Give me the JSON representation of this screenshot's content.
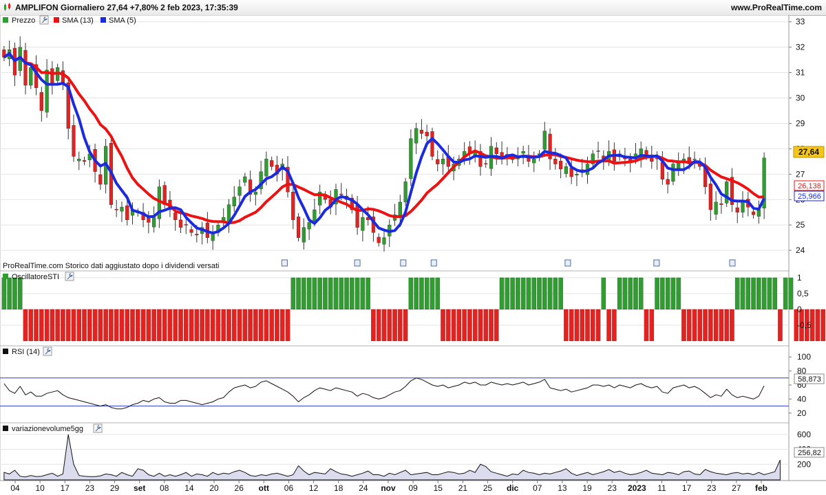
{
  "header": {
    "title": "AMPLIFON Giornaliero 27,64 +7,80% 2 feb 2023, 17:35:39",
    "site": "www.ProRealTime.com"
  },
  "colors": {
    "up": "#2e9e2e",
    "down": "#e8201e",
    "sma13": "#ee1111",
    "sma5": "#1a2ae0",
    "grid": "#e3e3e3",
    "rsi_band": "#2b3acd",
    "last_badge": "#f5c518"
  },
  "price_panel": {
    "legend": [
      {
        "label": "Prezzo",
        "color": "#2e9e2e",
        "has_tool": true
      },
      {
        "label": "SMA (13)",
        "color": "#ee1111",
        "has_tool": false
      },
      {
        "label": "SMA (5)",
        "color": "#1a2ae0",
        "has_tool": false
      }
    ],
    "y_ticks": [
      "33",
      "32",
      "31",
      "30",
      "29",
      "28",
      "27",
      "26",
      "25",
      "24"
    ],
    "last_price": "27,64",
    "sma13_last": "26,138",
    "sma5_last": "25,966",
    "footer_note": "ProRealTime.com  Storico dati aggiustato dopo i dividendi versati"
  },
  "oscillator_panel": {
    "label": "OscillatoreSTI",
    "y_ticks": [
      "1",
      "0,5",
      "0",
      "-0,5"
    ]
  },
  "rsi_panel": {
    "label": "RSI (14)",
    "y_ticks": [
      "100",
      "80",
      "60",
      "40",
      "20"
    ],
    "last_value": "58,873"
  },
  "volume_panel": {
    "label": "variazionevolume5gg",
    "y_ticks": [
      "600",
      "400",
      "200"
    ],
    "last_value": "256,82"
  },
  "x_axis": [
    {
      "label": "04",
      "bold": false
    },
    {
      "label": "10",
      "bold": false
    },
    {
      "label": "17",
      "bold": false
    },
    {
      "label": "23",
      "bold": false
    },
    {
      "label": "29",
      "bold": false
    },
    {
      "label": "set",
      "bold": true
    },
    {
      "label": "08",
      "bold": false
    },
    {
      "label": "14",
      "bold": false
    },
    {
      "label": "20",
      "bold": false
    },
    {
      "label": "26",
      "bold": false
    },
    {
      "label": "ott",
      "bold": true
    },
    {
      "label": "06",
      "bold": false
    },
    {
      "label": "12",
      "bold": false
    },
    {
      "label": "18",
      "bold": false
    },
    {
      "label": "24",
      "bold": false
    },
    {
      "label": "nov",
      "bold": true
    },
    {
      "label": "09",
      "bold": false
    },
    {
      "label": "15",
      "bold": false
    },
    {
      "label": "21",
      "bold": false
    },
    {
      "label": "25",
      "bold": false
    },
    {
      "label": "dic",
      "bold": true
    },
    {
      "label": "07",
      "bold": false
    },
    {
      "label": "13",
      "bold": false
    },
    {
      "label": "19",
      "bold": false
    },
    {
      "label": "23",
      "bold": false
    },
    {
      "label": "2023",
      "bold": true
    },
    {
      "label": "11",
      "bold": false
    },
    {
      "label": "17",
      "bold": false
    },
    {
      "label": "23",
      "bold": false
    },
    {
      "label": "27",
      "bold": false
    },
    {
      "label": "feb",
      "bold": true
    }
  ],
  "chart_data": [
    {
      "type": "candlestick",
      "title": "AMPLIFON Giornaliero",
      "ylim": [
        23.3,
        33.1
      ],
      "note": "approximate daily closes read from chart, 4 Aug 2022 - 2 Feb 2023",
      "close": [
        31.6,
        31.9,
        30.9,
        32.0,
        30.5,
        31.2,
        30.4,
        29.5,
        31.1,
        30.5,
        31.2,
        30.6,
        28.8,
        27.7,
        27.6,
        27.5,
        27.8,
        27.1,
        26.6,
        28.1,
        25.8,
        25.6,
        25.7,
        25.2,
        25.6,
        25.5,
        25.2,
        25.1,
        25.3,
        26.5,
        25.8,
        25.6,
        25.2,
        24.9,
        25.0,
        24.7,
        24.6,
        24.9,
        24.5,
        24.7,
        25.0,
        25.3,
        25.8,
        26.1,
        26.5,
        26.9,
        26.2,
        26.3,
        27.1,
        27.6,
        27.3,
        27.0,
        27.4,
        26.3,
        25.2,
        24.5,
        24.9,
        25.1,
        25.6,
        26.3,
        26.0,
        25.7,
        26.4,
        26.2,
        26.0,
        25.6,
        24.9,
        25.3,
        25.2,
        24.7,
        24.3,
        24.5,
        25.0,
        25.4,
        25.9,
        26.7,
        28.4,
        28.8,
        28.6,
        28.5,
        27.7,
        27.4,
        27.6,
        27.3,
        27.4,
        27.6,
        27.9,
        27.8,
        27.9,
        27.3,
        27.4,
        28.1,
        27.8,
        27.6,
        27.7,
        27.6,
        27.7,
        27.9,
        27.5,
        27.6,
        27.8,
        28.7,
        27.6,
        27.4,
        27.2,
        27.3,
        26.9,
        27.0,
        27.1,
        27.4,
        27.8,
        27.9,
        27.6,
        27.9,
        27.5,
        27.8,
        27.6,
        27.5,
        27.8,
        28.0,
        27.7,
        27.5,
        27.6,
        26.8,
        26.6,
        27.4,
        27.5,
        27.6,
        27.4,
        27.6,
        27.3,
        26.5,
        25.6,
        25.9,
        25.8,
        26.7,
        25.8,
        25.5,
        25.9,
        25.7,
        25.4,
        25.6,
        27.64
      ],
      "series": [
        {
          "name": "SMA (13)",
          "last": 26.138
        },
        {
          "name": "SMA (5)",
          "last": 25.966
        }
      ]
    },
    {
      "type": "bar",
      "title": "OscillatoreSTI",
      "ylim": [
        -1,
        1
      ],
      "values": [
        1,
        1,
        1,
        1,
        -1,
        -1,
        -1,
        -1,
        -1,
        -1,
        -1,
        -1,
        -1,
        -1,
        -1,
        -1,
        -1,
        -1,
        -1,
        -1,
        -1,
        -1,
        -1,
        -1,
        -1,
        -1,
        -1,
        -1,
        -1,
        -1,
        -1,
        -1,
        -1,
        -1,
        -1,
        -1,
        -1,
        -1,
        -1,
        -1,
        -1,
        -1,
        -1,
        -1,
        -1,
        -1,
        -1,
        -1,
        -1,
        -1,
        -1,
        -1,
        -1,
        -1,
        1,
        1,
        1,
        1,
        1,
        1,
        1,
        1,
        1,
        1,
        1,
        1,
        1,
        1,
        1,
        -1,
        -1,
        -1,
        -1,
        -1,
        -1,
        -1,
        1,
        1,
        1,
        1,
        1,
        1,
        -1,
        -1,
        -1,
        -1,
        -1,
        -1,
        -1,
        -1,
        -1,
        -1,
        -1,
        1,
        1,
        1,
        1,
        1,
        1,
        1,
        1,
        1,
        1,
        1,
        1,
        -1,
        -1,
        -1,
        -1,
        -1,
        -1,
        -1,
        1,
        -1,
        -1,
        1,
        1,
        1,
        1,
        1,
        -1,
        -1,
        1,
        1,
        1,
        1,
        1,
        -1,
        -1,
        -1,
        -1,
        -1,
        -1,
        -1,
        -1,
        -1,
        -1,
        1,
        1,
        1,
        1,
        1,
        1,
        1,
        1,
        -1,
        1,
        1,
        -1,
        -1,
        -1,
        -1,
        -1,
        -1,
        -1,
        -1,
        -1,
        -1,
        -1,
        -1,
        -1,
        -1,
        -1,
        -1,
        -1,
        -1,
        1
      ]
    },
    {
      "type": "line",
      "title": "RSI (14)",
      "ylim": [
        10,
        110
      ],
      "bands": [
        30,
        70
      ],
      "values": [
        62,
        52,
        48,
        58,
        46,
        50,
        44,
        44,
        48,
        50,
        52,
        46,
        42,
        40,
        38,
        36,
        34,
        32,
        30,
        32,
        28,
        26,
        26,
        28,
        32,
        34,
        38,
        36,
        40,
        42,
        36,
        34,
        34,
        38,
        38,
        36,
        34,
        32,
        34,
        36,
        40,
        42,
        50,
        56,
        58,
        60,
        56,
        58,
        64,
        66,
        62,
        58,
        54,
        50,
        44,
        36,
        42,
        46,
        52,
        56,
        54,
        52,
        56,
        54,
        52,
        50,
        44,
        48,
        46,
        42,
        40,
        42,
        46,
        50,
        52,
        58,
        66,
        70,
        68,
        64,
        60,
        58,
        60,
        56,
        58,
        60,
        64,
        62,
        64,
        60,
        60,
        64,
        62,
        60,
        62,
        60,
        62,
        64,
        60,
        62,
        64,
        68,
        56,
        54,
        52,
        54,
        50,
        52,
        54,
        56,
        60,
        60,
        58,
        60,
        56,
        60,
        58,
        56,
        60,
        62,
        58,
        56,
        58,
        50,
        48,
        56,
        58,
        60,
        56,
        58,
        54,
        48,
        42,
        46,
        44,
        54,
        46,
        42,
        44,
        42,
        40,
        44,
        58.873
      ]
    },
    {
      "type": "area",
      "title": "variazionevolume5gg",
      "ylim": [
        0,
        700
      ],
      "values": [
        90,
        70,
        120,
        40,
        30,
        50,
        35,
        40,
        60,
        80,
        40,
        70,
        600,
        200,
        50,
        40,
        35,
        35,
        45,
        70,
        60,
        40,
        90,
        60,
        40,
        140,
        120,
        60,
        40,
        80,
        40,
        60,
        40,
        60,
        90,
        40,
        70,
        60,
        40,
        90,
        60,
        80,
        70,
        100,
        120,
        90,
        50,
        40,
        60,
        50,
        70,
        80,
        60,
        40,
        60,
        180,
        110,
        60,
        90,
        80,
        70,
        140,
        100,
        70,
        60,
        40,
        60,
        80,
        110,
        60,
        60,
        40,
        80,
        60,
        90,
        120,
        60,
        70,
        80,
        90,
        60,
        60,
        80,
        100,
        90,
        70,
        80,
        120,
        90,
        200,
        170,
        100,
        80,
        60,
        40,
        70,
        60,
        120,
        90,
        80,
        60,
        80,
        70,
        90,
        110,
        140,
        80,
        50,
        70,
        90,
        60,
        80,
        100,
        130,
        90,
        110,
        80,
        60,
        70,
        90,
        120,
        80,
        70,
        60,
        90,
        80,
        60,
        100,
        110,
        70,
        60,
        130,
        100,
        80,
        70,
        60,
        80,
        90,
        70,
        80,
        60,
        90,
        60,
        80,
        100,
        256.82
      ]
    }
  ]
}
